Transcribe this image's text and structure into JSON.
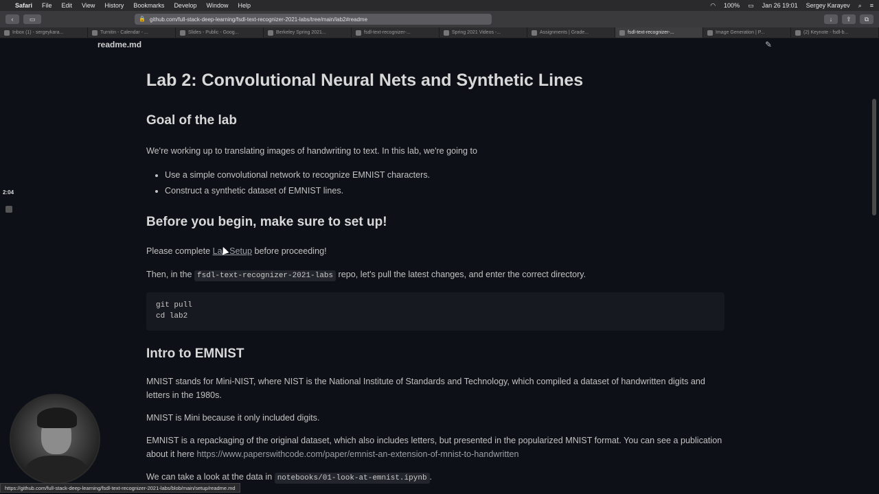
{
  "menubar": {
    "app": "Safari",
    "items": [
      "File",
      "Edit",
      "View",
      "History",
      "Bookmarks",
      "Develop",
      "Window",
      "Help"
    ],
    "battery": "100%",
    "clock": "Jan 26  19:01",
    "user": "Sergey Karayev"
  },
  "toolbar": {
    "url": "github.com/full-stack-deep-learning/fsdl-text-recognizer-2021-labs/tree/main/lab2#readme"
  },
  "tabs": [
    "Inbox (1) - sergeykara...",
    "Turnitin - Calendar - ...",
    "Slides - Public - Goog...",
    "Berkeley Spring 2021...",
    "fsdl-text-recognizer-...",
    "Spring 2021 Videos -...",
    "Assignments | Grade...",
    "fsdl-text-recognizer-...",
    "Image Generation | P...",
    "(2) Keynote - fsdl-b..."
  ],
  "active_tab": 7,
  "page": {
    "file_title": "readme.md",
    "h1": "Lab 2: Convolutional Neural Nets and Synthetic Lines",
    "goal_heading": "Goal of the lab",
    "goal_intro": "We're working up to translating images of handwriting to text. In this lab, we're going to",
    "goal_items": [
      "Use a simple convolutional network to recognize EMNIST characters.",
      "Construct a synthetic dataset of EMNIST lines."
    ],
    "before_heading": "Before you begin, make sure to set up!",
    "complete_pre": "Please complete ",
    "complete_link": "Lab Setup",
    "complete_post": " before proceeding!",
    "then_pre": "Then, in the ",
    "then_code": "fsdl-text-recognizer-2021-labs",
    "then_post": " repo, let's pull the latest changes, and enter the correct directory.",
    "code_lines": [
      "git pull",
      "cd lab2"
    ],
    "intro_heading": "Intro to EMNIST",
    "mnist_p1": "MNIST stands for Mini-NIST, where NIST is the National Institute of Standards and Technology, which compiled a dataset of handwritten digits and letters in the 1980s.",
    "mnist_p2": "MNIST is Mini because it only included digits.",
    "emnist_pre": "EMNIST is a repackaging of the original dataset, which also includes letters, but presented in the popularized MNIST format. You can see a publication about it here ",
    "emnist_link": "https://www.paperswithcode.com/paper/emnist-an-extension-of-mnist-to-handwritten",
    "look_pre": "We can take a look at the data in ",
    "look_code": "notebooks/01-look-at-emnist.ipynb",
    "look_post": "."
  },
  "overlay": {
    "timer": "2:04",
    "status_url": "https://github.com/full-stack-deep-learning/fsdl-text-recognizer-2021-labs/blob/main/setup/readme.md"
  }
}
